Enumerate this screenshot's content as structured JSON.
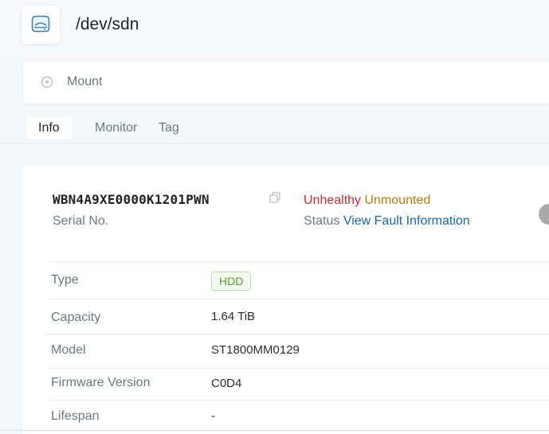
{
  "header": {
    "title": "/dev/sdn",
    "icon": "disk-icon"
  },
  "actions": {
    "mount_label": "Mount",
    "icon": "plus-circle-icon"
  },
  "tabs": [
    {
      "label": "Info",
      "active": true
    },
    {
      "label": "Monitor",
      "active": false
    },
    {
      "label": "Tag",
      "active": false
    }
  ],
  "disk": {
    "serial_value": "WBN4A9XE0000K1201PWN",
    "serial_label": "Serial No.",
    "health": "Unhealthy",
    "mount_state": "Unmounted",
    "status_label": "Status",
    "fault_link": "View Fault Information"
  },
  "properties": [
    {
      "label": "Type",
      "value": "HDD"
    },
    {
      "label": "Capacity",
      "value": "1.64 TiB"
    },
    {
      "label": "Model",
      "value": "ST1800MM0129"
    },
    {
      "label": "Firmware Version",
      "value": "C0D4"
    },
    {
      "label": "Lifespan",
      "value": "-"
    }
  ],
  "colors": {
    "unhealthy": "#cc2a2a",
    "unmounted": "#b47c06",
    "link": "#1466b8",
    "hdd_badge": "#52a12c"
  }
}
